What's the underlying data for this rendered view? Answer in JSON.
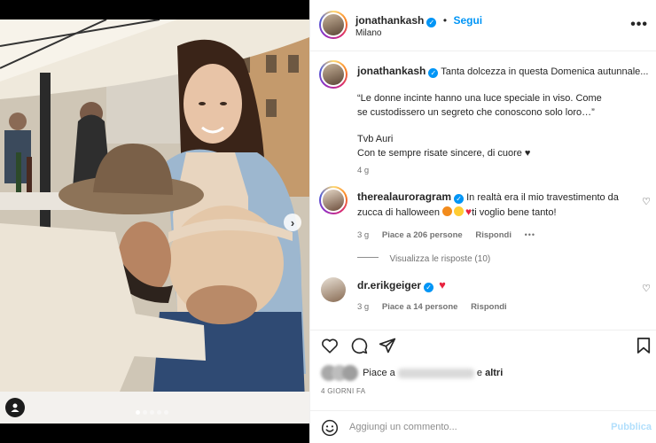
{
  "header": {
    "username": "jonathankash",
    "separator": "•",
    "follow_label": "Segui",
    "location": "Milano",
    "more_icon": "more-horizontal-icon"
  },
  "caption": {
    "username": "jonathankash",
    "first_line": "Tanta dolcezza in questa Domenica autunnale...",
    "quote": "“Le donne incinte hanno una luce speciale in viso. Come se custodissero un segreto che conoscono solo loro…”",
    "sign": "Tvb Auri",
    "closing": "Con te sempre risate sincere, di cuore ♥",
    "time": "4 g"
  },
  "comments": [
    {
      "username": "therealauroragram",
      "text": "In realtà era il mio travestimento da zucca di halloween",
      "emoji": [
        "jack-o-lantern",
        "grin-emoji",
        "red-heart"
      ],
      "text_after": "ti voglio bene tanto!",
      "time": "3 g",
      "likes": "Piace a 206 persone",
      "reply_label": "Rispondi",
      "more": "•••",
      "replies_label": "Visualizza le risposte (10)"
    },
    {
      "username": "dr.erikgeiger",
      "emoji": [
        "red-heart"
      ],
      "time": "3 g",
      "likes": "Piace a 14 persone",
      "reply_label": "Rispondi"
    }
  ],
  "actions": {
    "like_icon": "heart-outline-icon",
    "comment_icon": "comment-icon",
    "share_icon": "paper-plane-icon",
    "save_icon": "bookmark-icon"
  },
  "likes_line": {
    "prefix": "Piace a",
    "joiner": "e",
    "others": "altri"
  },
  "date": "4 GIORNI FA",
  "comment_bar": {
    "placeholder": "Aggiungi un commento...",
    "publish_label": "Pubblica",
    "emoji_icon": "smiley-icon"
  },
  "photo": {
    "next_icon": "chevron-right-icon",
    "tag_icon": "user-tag-icon",
    "carousel_total": 5,
    "carousel_active": 1
  },
  "colors": {
    "accent": "#0095f6",
    "heart": "#ed4956",
    "publish_disabled": "#b2dffc"
  }
}
